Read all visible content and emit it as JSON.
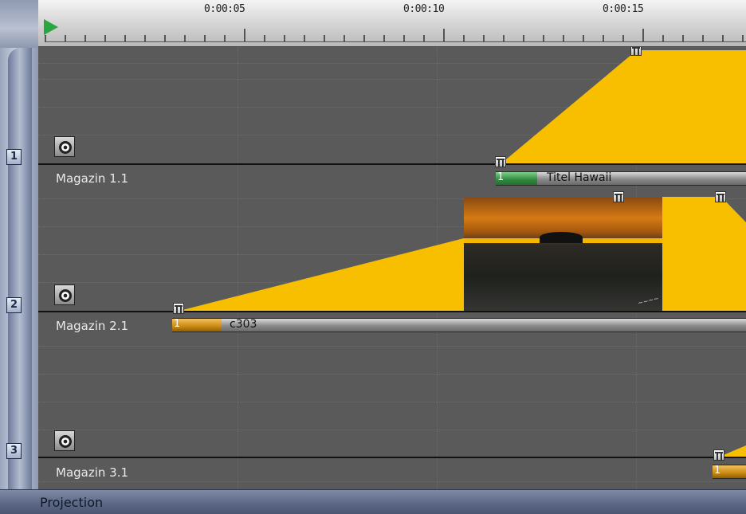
{
  "ruler": {
    "time_labels": [
      "0:00:05",
      "0:00:10",
      "0:00:15"
    ]
  },
  "tracks": [
    {
      "number": "1",
      "name": "Magazin 1.1",
      "clip": {
        "index": "1",
        "name": "Titel Hawaii"
      }
    },
    {
      "number": "2",
      "name": "Magazin 2.1",
      "clip": {
        "index": "1",
        "name": "c303"
      }
    },
    {
      "number": "3",
      "name": "Magazin 3.1",
      "clip": {
        "index": "1",
        "name": ""
      }
    }
  ],
  "status": {
    "label": "Projection"
  },
  "colors": {
    "envelope": "#f7bf00",
    "clip_titel": "#3a9a4c",
    "clip_image": "#c98a10",
    "background": "#5a5a5a"
  },
  "icons": {
    "play": "play-icon",
    "speaker": "speaker-icon",
    "marker": "keyframe-marker-icon"
  }
}
